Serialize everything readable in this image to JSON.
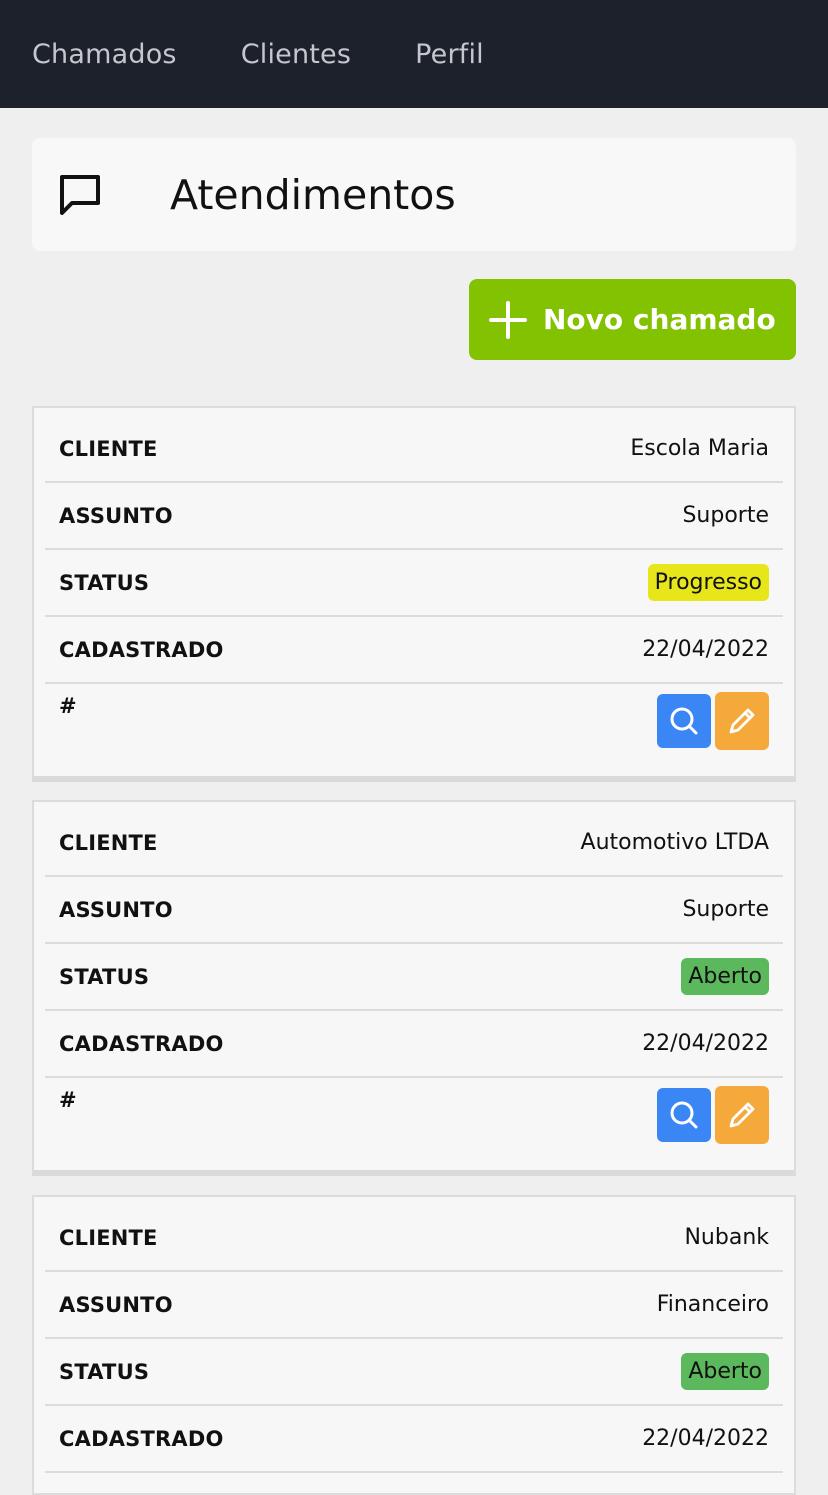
{
  "nav": {
    "items": [
      "Chamados",
      "Clientes",
      "Perfil"
    ]
  },
  "page": {
    "title": "Atendimentos",
    "new_button_label": "Novo chamado"
  },
  "labels": {
    "cliente": "CLIENTE",
    "assunto": "ASSUNTO",
    "status": "STATUS",
    "cadastrado": "CADASTRADO",
    "actions": "#"
  },
  "tickets": [
    {
      "cliente": "Escola Maria",
      "assunto": "Suporte",
      "status": "Progresso",
      "cadastrado": "22/04/2022"
    },
    {
      "cliente": "Automotivo LTDA",
      "assunto": "Suporte",
      "status": "Aberto",
      "cadastrado": "22/04/2022"
    },
    {
      "cliente": "Nubank",
      "assunto": "Financeiro",
      "status": "Aberto",
      "cadastrado": "22/04/2022"
    }
  ],
  "colors": {
    "topbar": "#1c212c",
    "new_button": "#83c200",
    "status_progress": "#e6e61a",
    "status_open": "#5cb85c",
    "view_button": "#3a86f5",
    "edit_button": "#f6a93b"
  },
  "icons": {
    "title": "chat-bubble-icon",
    "new_button": "plus-icon",
    "view": "search-icon",
    "edit": "pencil-icon"
  }
}
